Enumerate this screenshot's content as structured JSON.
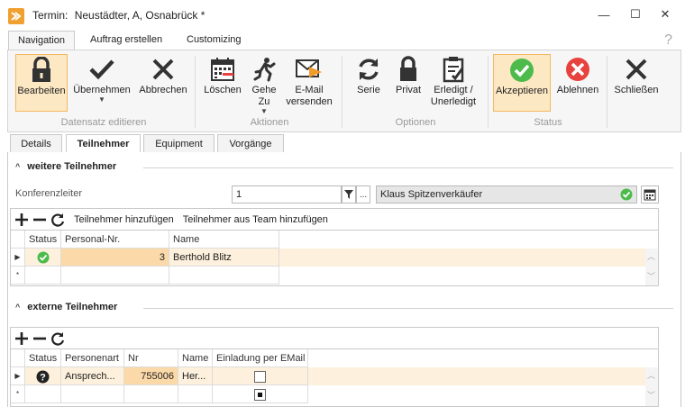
{
  "window": {
    "title_prefix": "Termin:",
    "title_record": "Neustädter, A, Osnabrück *",
    "minimize": "—",
    "maximize": "☐",
    "close": "✕"
  },
  "ribbon_tabs": [
    {
      "label": "Navigation",
      "active": true
    },
    {
      "label": "Auftrag erstellen",
      "active": false
    },
    {
      "label": "Customizing",
      "active": false
    }
  ],
  "help_label": "?",
  "ribbon": {
    "buttons": {
      "bearbeiten": "Bearbeiten",
      "uebernehmen": "Übernehmen",
      "abbrechen": "Abbrechen",
      "loeschen": "Löschen",
      "gehe_zu_1": "Gehe",
      "gehe_zu_2": "Zu",
      "email_1": "E-Mail",
      "email_2": "versenden",
      "serie": "Serie",
      "privat": "Privat",
      "erledigt_1": "Erledigt /",
      "erledigt_2": "Unerledigt",
      "akzeptieren": "Akzeptieren",
      "ablehnen": "Ablehnen",
      "schliessen": "Schließen"
    },
    "groups": {
      "datensatz": "Datensatz editieren",
      "aktionen": "Aktionen",
      "optionen": "Optionen",
      "status": "Status"
    },
    "dropdown_glyph": "▼"
  },
  "content_tabs": [
    {
      "label": "Details",
      "active": false
    },
    {
      "label": "Teilnehmer",
      "active": true
    },
    {
      "label": "Equipment",
      "active": false
    },
    {
      "label": "Vorgänge",
      "active": false
    }
  ],
  "weitere": {
    "title": "weitere Teilnehmer",
    "caret": "^",
    "konferenzleiter_label": "Konferenzleiter",
    "konferenzleiter_value": "1",
    "ellipsis": "...",
    "leiter_name": "Klaus Spitzenverkäufer",
    "toolbar_add_participant": "Teilnehmer hinzufügen",
    "toolbar_add_team": "Teilnehmer aus Team hinzufügen",
    "columns": [
      "Status",
      "Personal-Nr.",
      "Name"
    ],
    "rows": [
      {
        "status": "accepted",
        "personal_nr": "3",
        "name": "Berthold Blitz"
      }
    ],
    "new_row_marker": "*",
    "current_row_marker": "▶"
  },
  "externe": {
    "title": "externe Teilnehmer",
    "caret": "^",
    "columns": [
      "Status",
      "Personenart",
      "Nr",
      "Name",
      "Einladung per EMail"
    ],
    "rows": [
      {
        "status": "unknown",
        "personenart": "Ansprech...",
        "nr": "755006",
        "name": "Her...",
        "einladung": false
      }
    ],
    "new_row_marker": "*",
    "current_row_marker": "▶",
    "new_row_einladung": "indeterminate"
  },
  "colors": {
    "accent_orange": "#f3b760",
    "highlight_row": "#fdf0dc",
    "accept_green": "#4cbb4c",
    "reject_red": "#e8423f"
  }
}
